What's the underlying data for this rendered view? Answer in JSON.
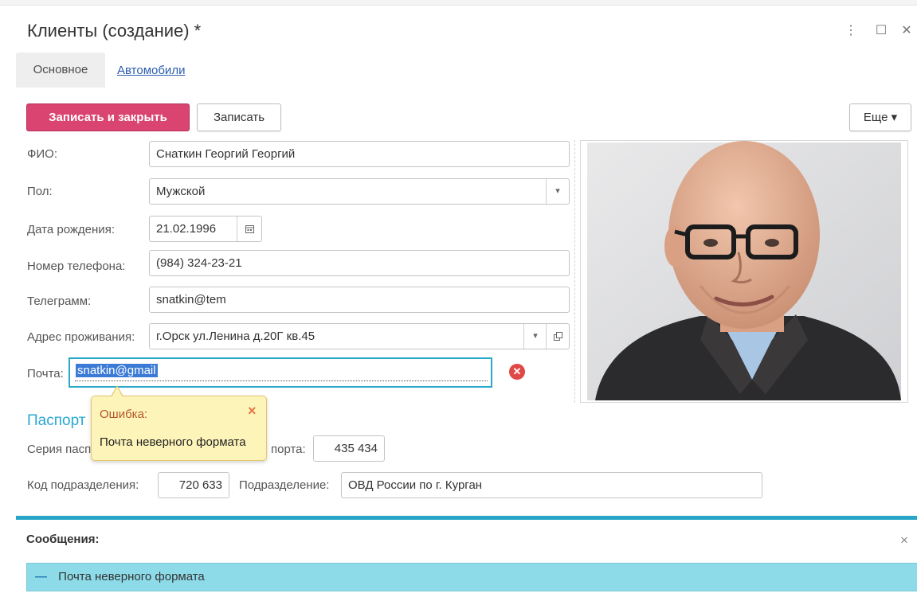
{
  "window": {
    "title": "Клиенты (создание) *",
    "menu_glyph": "⋮",
    "maximize_glyph": "☐",
    "close_glyph": "✕"
  },
  "tabs": {
    "main": "Основное",
    "cars": "Автомобили"
  },
  "toolbar": {
    "save_close": "Записать и закрыть",
    "save": "Записать",
    "more": "Еще ▾"
  },
  "form": {
    "fio": {
      "label": "ФИО:",
      "value": "Снаткин Георгий Георгий"
    },
    "gender": {
      "label": "Пол:",
      "value": "Мужской"
    },
    "birth": {
      "label": "Дата рождения:",
      "value": "21.02.1996"
    },
    "phone": {
      "label": "Номер телефона:",
      "value": "(984) 324-23-21"
    },
    "telegram": {
      "label": "Телеграмм:",
      "value": "snatkin@tem"
    },
    "address": {
      "label": "Адрес проживания:",
      "value": "г.Орск ул.Ленина д.20Г кв.45"
    },
    "email": {
      "label": "Почта:",
      "value": "snatkin@gmail"
    }
  },
  "passport": {
    "title": "Паспорт",
    "series_label": "Серия пасп",
    "number_label": "порта:",
    "number_value": "435 434",
    "code_label": "Код подразделения:",
    "code_value": "720 633",
    "dept_label": "Подразделение:",
    "dept_value": "ОВД России по г. Курган"
  },
  "tooltip": {
    "title": "Ошибка:",
    "message": "Почта неверного формата",
    "close": "×"
  },
  "messages": {
    "title": "Сообщения:",
    "close": "×",
    "item": "Почта неверного формата",
    "item_marker": "—"
  },
  "colors": {
    "accent": "#d94470",
    "error": "#e04848",
    "highlight": "#8ddbe8",
    "link": "#2a5dad",
    "section": "#2aa8d2"
  }
}
